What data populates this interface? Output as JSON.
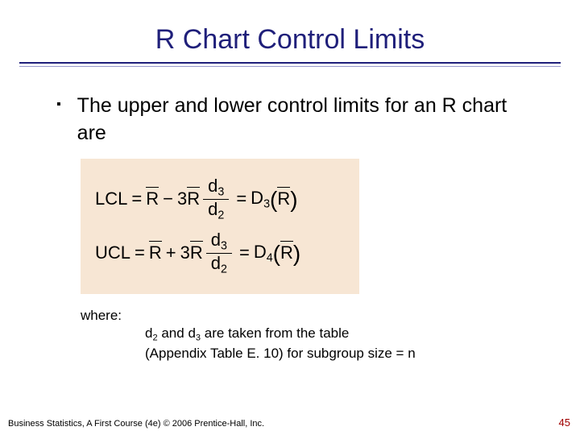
{
  "title": "R Chart Control Limits",
  "bullet": {
    "text": "The upper and lower control limits for an R chart are"
  },
  "formula": {
    "lcl_label": "LCL",
    "ucl_label": "UCL",
    "eq": "=",
    "minus": "−",
    "plus": "+",
    "three": "3",
    "R": "R",
    "d2": "d",
    "d2_sub": "2",
    "d3": "d",
    "d3_sub": "3",
    "D3": "D",
    "D3_sub": "3",
    "D4": "D",
    "D4_sub": "4",
    "lp": "(",
    "rp": ")"
  },
  "where": {
    "label": "where:",
    "line1_a": "d",
    "line1_a_sub": "2",
    "line1_mid": " and ",
    "line1_b": "d",
    "line1_b_sub": "3",
    "line1_tail": "  are taken from the table",
    "line2": "(Appendix Table E. 10) for subgroup size = n"
  },
  "footer": "Business Statistics, A First Course (4e) © 2006 Prentice-Hall, Inc.",
  "page_num": "45"
}
